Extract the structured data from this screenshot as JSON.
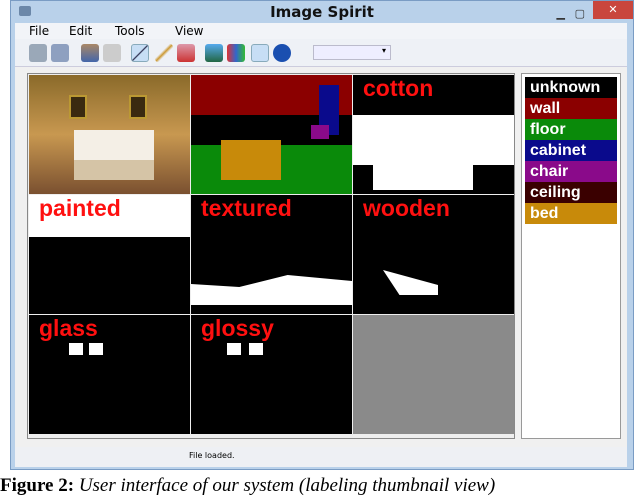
{
  "window": {
    "title": "Image Spirit",
    "minimize": "▁",
    "maximize": "▢",
    "close": "✕"
  },
  "menu": [
    "File",
    "Edit",
    "Tools",
    "View"
  ],
  "toolbar": {
    "icons": [
      "open-icon",
      "save-icon",
      "user-icon",
      "undo-icon",
      "line-tool-icon",
      "brush-icon",
      "eraser-icon",
      "image-icon",
      "segments-icon",
      "thumbnail-view-icon",
      "play-icon"
    ],
    "combo_value": ""
  },
  "thumbnails": [
    {
      "label": ""
    },
    {
      "label": ""
    },
    {
      "label": "cotton"
    },
    {
      "label": "painted"
    },
    {
      "label": "textured"
    },
    {
      "label": "wooden"
    },
    {
      "label": "glass"
    },
    {
      "label": "glossy"
    },
    {
      "label": ""
    }
  ],
  "legend": [
    {
      "label": "unknown",
      "color": "#000000"
    },
    {
      "label": "wall",
      "color": "#8b0000"
    },
    {
      "label": "floor",
      "color": "#0a8a0a"
    },
    {
      "label": "cabinet",
      "color": "#0a0a8c"
    },
    {
      "label": "chair",
      "color": "#8a0a8a"
    },
    {
      "label": "ceiling",
      "color": "#3a0000"
    },
    {
      "label": "bed",
      "color": "#c88a0a"
    }
  ],
  "status": "File loaded.",
  "caption": {
    "prefix": "Figure 2:",
    "text": "User interface of our system (labeling thumbnail view)"
  }
}
